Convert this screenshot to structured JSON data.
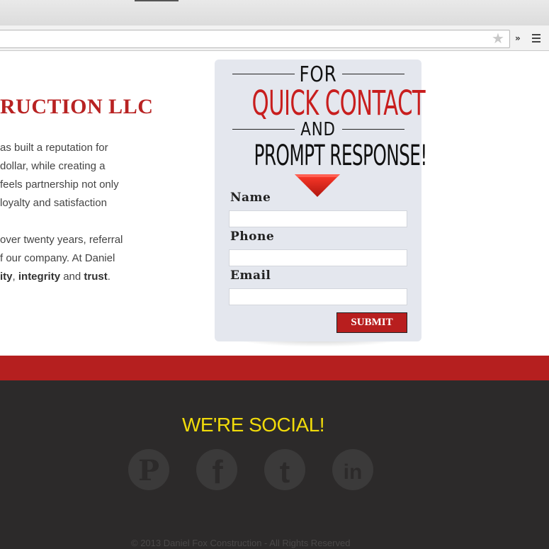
{
  "browser": {
    "star_glyph": "★",
    "overflow_glyph": "»"
  },
  "page": {
    "company_title": "RUCTION LLC",
    "about_lines": [
      "as built a reputation for",
      "dollar, while creating a",
      "feels partnership not only",
      "loyalty and satisfaction",
      "",
      "over twenty years, referral",
      "f our company. At Daniel"
    ],
    "values_line": {
      "part1": "ity",
      "sep1": ", ",
      "part2": "integrity",
      "sep2": " and ",
      "part3": "trust",
      "end": "."
    }
  },
  "contact": {
    "for": "FOR",
    "headline": "QUICK CONTACT",
    "and": "AND",
    "subheadline": "PROMPT RESPONSE!",
    "name_label": "Name",
    "name_value": "",
    "phone_label": "Phone",
    "phone_value": "",
    "email_label": "Email",
    "email_value": "",
    "submit_label": "SUBMIT"
  },
  "footer": {
    "social_title": "WE'RE SOCIAL!",
    "social_icons": [
      "pinterest-icon",
      "facebook-icon",
      "twitter-icon",
      "linkedin-icon"
    ],
    "copyright": "© 2013 Daniel Fox Construction - All Rights Reserved"
  },
  "colors": {
    "brand_red": "#b82222",
    "footer_dark": "#2c2a2a",
    "social_yellow": "#f1db0a",
    "card_bg": "#e4e7ee"
  }
}
